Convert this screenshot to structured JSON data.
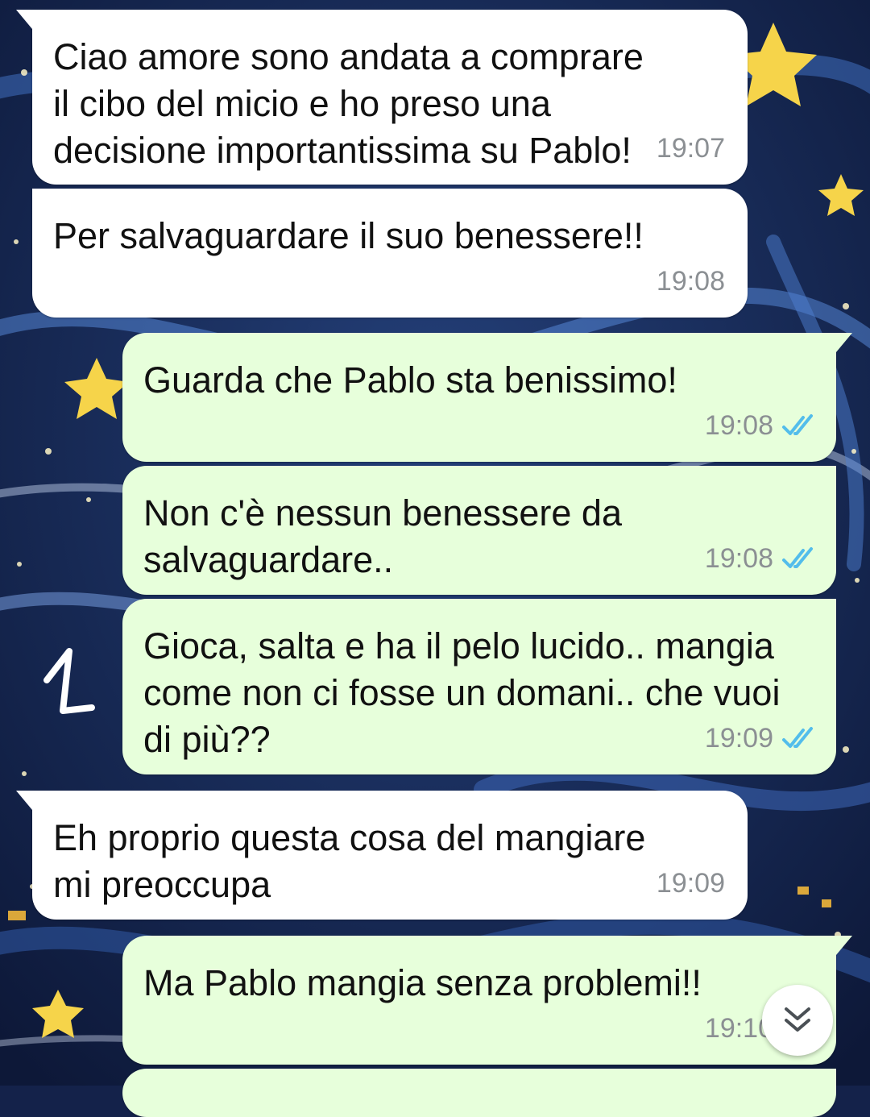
{
  "messages": [
    {
      "direction": "in",
      "text": "Ciao amore sono andata a comprare il cibo del micio e ho preso una decisione importantissima su Pablo!",
      "time": "19:07"
    },
    {
      "direction": "in",
      "text": "Per salvaguardare il suo benessere!!",
      "time": "19:08"
    },
    {
      "direction": "out",
      "text": "Guarda che Pablo sta benissimo!",
      "time": "19:08",
      "status": "read"
    },
    {
      "direction": "out",
      "text": "Non c'è nessun benessere da salvaguardare..",
      "time": "19:08",
      "status": "read"
    },
    {
      "direction": "out",
      "text": "Gioca, salta e ha il pelo lucido.. mangia come non ci fosse un domani.. che vuoi di più??",
      "time": "19:09",
      "status": "read"
    },
    {
      "direction": "in",
      "text": "Eh proprio questa cosa del mangiare mi preoccupa",
      "time": "19:09"
    },
    {
      "direction": "out",
      "text": "Ma Pablo mangia senza problemi!!",
      "time": "19:10",
      "status": "read"
    }
  ],
  "colors": {
    "incoming_bubble": "#ffffff",
    "outgoing_bubble": "#e7ffdb",
    "read_ticks": "#53bdeb",
    "timestamp": "#8b8f93"
  },
  "icons": {
    "read_receipt": "double-check-icon",
    "scroll_down": "double-chevron-down-icon"
  }
}
